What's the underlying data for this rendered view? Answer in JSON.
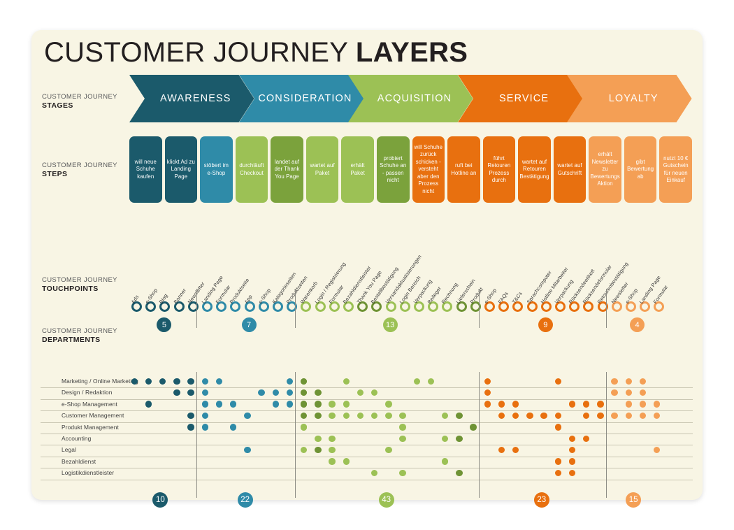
{
  "title": {
    "light": "CUSTOMER JOURNEY ",
    "bold": "LAYERS"
  },
  "captions": {
    "stages": {
      "small": "CUSTOMER JOURNEY",
      "big": "STAGES"
    },
    "steps": {
      "small": "CUSTOMER JOURNEY",
      "big": "STEPS"
    },
    "touchpoints": {
      "small": "CUSTOMER JOURNEY",
      "big": "TOUCHPOINTS"
    },
    "departments": {
      "small": "CUSTOMER JOURNEY",
      "big": "DEPARTMENTS"
    }
  },
  "colors": {
    "card_bg": "#f8f5e4",
    "awareness": "#1b5a6b",
    "consideration": "#2f8ba8",
    "acquisition": "#9cc155",
    "acquisition_dark": "#6f9335",
    "service": "#e8700f",
    "loyalty": "#f49f55",
    "text_dark": "#231f20"
  },
  "stages": [
    {
      "label": "AWARENESS",
      "color": "#1b5a6b"
    },
    {
      "label": "CONSIDERATION",
      "color": "#2f8ba8"
    },
    {
      "label": "ACQUISITION",
      "color": "#9cc155"
    },
    {
      "label": "SERVICE",
      "color": "#e8700f"
    },
    {
      "label": "LOYALTY",
      "color": "#f49f55"
    }
  ],
  "steps": [
    {
      "label": "will neue Schuhe kaufen",
      "color": "#1b5a6b"
    },
    {
      "label": "klickt Ad zu Landing Page",
      "color": "#1b5a6b"
    },
    {
      "label": "stöbert im e-Shop",
      "color": "#2f8ba8"
    },
    {
      "label": "durchläuft Checkout",
      "color": "#9cc155"
    },
    {
      "label": "landet auf der Thank You Page",
      "color": "#7ba23c"
    },
    {
      "label": "wartet auf Paket",
      "color": "#9cc155"
    },
    {
      "label": "erhält Paket",
      "color": "#9cc155"
    },
    {
      "label": "probiert Schuhe an - passen nicht",
      "color": "#7ba23c"
    },
    {
      "label": "will Schuhe zurück schicken - versteht aber den Prozess nicht",
      "color": "#e8700f"
    },
    {
      "label": "ruft bei Hotline an",
      "color": "#e8700f"
    },
    {
      "label": "führt Retouren Prozess durch",
      "color": "#e8700f"
    },
    {
      "label": "wartet auf Retouren Bestätigung",
      "color": "#e8700f"
    },
    {
      "label": "wartet auf Gutschrift",
      "color": "#e8700f"
    },
    {
      "label": "erhält Newsletter zu Bewertungs Aktion",
      "color": "#f49f55"
    },
    {
      "label": "gibt Bewertung ab",
      "color": "#f49f55"
    },
    {
      "label": "nutzt 10 € Gutschein für neuen Einkauf",
      "color": "#f49f55"
    }
  ],
  "touchpoint_groups": [
    {
      "stage": "awareness",
      "count_badge": "5",
      "color": "#1b5a6b",
      "labels": [
        "Ads",
        "e-Shop",
        "Blog",
        "Banner",
        "Newsletter"
      ]
    },
    {
      "stage": "consideration",
      "count_badge": "7",
      "color": "#2f8ba8",
      "labels": [
        "Landing Page",
        "Formular",
        "Produktseite",
        "App",
        "e-Shop",
        "Kategorieseiten",
        "Produktseiten"
      ]
    },
    {
      "stage": "acquisition",
      "count_badge": "13",
      "color": "#9cc155",
      "labels": [
        "Warenkorb",
        "Login / Registrierung",
        "Formular",
        "Bezahldienstleister",
        "Thank You Page",
        "Bestellbestätigung",
        "Versandaktualisierungen",
        "Login Bereich",
        "Verpackung",
        "Beileger",
        "Rechnung",
        "Lieferschein",
        "Produkt"
      ],
      "dark_indices": [
        4,
        5,
        11,
        12
      ]
    },
    {
      "stage": "service",
      "count_badge": "9",
      "color": "#e8700f",
      "labels": [
        "e-Shop",
        "FAQs",
        "T&Cs",
        "Sprachcomputer",
        "Hotline Mitarbeiter",
        "Verpackung",
        "Rücksendeetikett",
        "Rücksendeformular",
        "Retourenbestätigung"
      ]
    },
    {
      "stage": "loyalty",
      "count_badge": "4",
      "color": "#f49f55",
      "labels": [
        "Newsletter",
        "e-Shop",
        "Landing Page",
        "Formular"
      ]
    }
  ],
  "departments": [
    "Marketing / Online Marketing",
    "Design / Redaktion",
    "e-Shop Management",
    "Customer Management",
    "Produkt Management",
    "Accounting",
    "Legal",
    "Bezahldienst",
    "Logistikdienstleister"
  ],
  "department_totals": [
    {
      "value": "10",
      "color": "#1b5a6b"
    },
    {
      "value": "22",
      "color": "#2f8ba8"
    },
    {
      "value": "43",
      "color": "#9cc155"
    },
    {
      "value": "23",
      "color": "#e8700f"
    },
    {
      "value": "15",
      "color": "#f49f55"
    }
  ],
  "chart_data": {
    "type": "heatmap",
    "title": "CUSTOMER JOURNEY LAYERS",
    "xlabel": "Touchpoints",
    "ylabel": "Departments",
    "columns": 38,
    "rows": 9,
    "group_column_ranges": [
      [
        0,
        4
      ],
      [
        5,
        11
      ],
      [
        12,
        24
      ],
      [
        25,
        33
      ],
      [
        34,
        37
      ]
    ],
    "matrix": [
      [
        0,
        1,
        2,
        3,
        4,
        5,
        6,
        11,
        12,
        12,
        15,
        20,
        21,
        25,
        30,
        34,
        35,
        36
      ],
      [
        3,
        4,
        5,
        9,
        10,
        11,
        12,
        12,
        13,
        16,
        17,
        25,
        34,
        35,
        36
      ],
      [
        1,
        5,
        6,
        7,
        10,
        11,
        12,
        12,
        13,
        14,
        15,
        18,
        25,
        26,
        27,
        31,
        32,
        33,
        35,
        36,
        37
      ],
      [
        4,
        5,
        8,
        12,
        13,
        14,
        15,
        16,
        17,
        18,
        19,
        22,
        23,
        26,
        27,
        28,
        29,
        30,
        32,
        33,
        34,
        35,
        36,
        37
      ],
      [
        4,
        5,
        7,
        12,
        12,
        19,
        24,
        30
      ],
      [
        13,
        14,
        19,
        22,
        23,
        31,
        32
      ],
      [
        8,
        12,
        13,
        14,
        18,
        26,
        27,
        31,
        37
      ],
      [
        14,
        15,
        22,
        30,
        31
      ],
      [
        17,
        19,
        23,
        30,
        31
      ]
    ],
    "dark_cells": [
      [
        0,
        12
      ],
      [
        1,
        12
      ],
      [
        1,
        13
      ],
      [
        2,
        12
      ],
      [
        2,
        13
      ],
      [
        3,
        12
      ],
      [
        3,
        13
      ],
      [
        3,
        23
      ],
      [
        4,
        24
      ],
      [
        5,
        23
      ],
      [
        6,
        13
      ],
      [
        8,
        23
      ]
    ],
    "group_totals": [
      10,
      22,
      43,
      23,
      15
    ],
    "touchpoint_counts": [
      5,
      7,
      13,
      9,
      4
    ]
  }
}
